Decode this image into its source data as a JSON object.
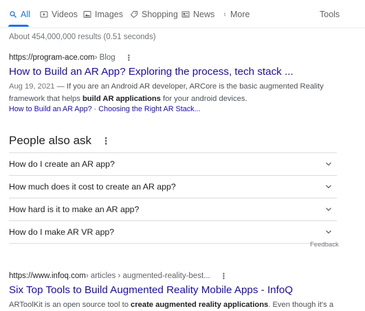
{
  "tabs": [
    {
      "label": "All",
      "icon": "search-icon",
      "active": true
    },
    {
      "label": "Videos",
      "icon": "video-icon"
    },
    {
      "label": "Images",
      "icon": "image-icon"
    },
    {
      "label": "Shopping",
      "icon": "tag-icon"
    },
    {
      "label": "News",
      "icon": "news-icon"
    },
    {
      "label": "More",
      "icon": "more-vert-icon"
    }
  ],
  "tools_label": "Tools",
  "stats": "About 454,000,000 results (0.51 seconds)",
  "result1": {
    "url": "https://program-ace.com",
    "crumb": " › Blog",
    "title": "How to Build an AR App? Exploring the process, tech stack ...",
    "date": "Aug 19, 2021",
    "snippet_a": " — If you are an Android AR developer, ARCore is the basic augmented Reality framework that helps ",
    "snippet_bold": "build AR applications",
    "snippet_b": " for your android devices.",
    "link1": "How to Build an AR App?",
    "link_sep": " · ",
    "link2": "Choosing the Right AR Stack..."
  },
  "paa": {
    "title": "People also ask",
    "questions": [
      "How do I create an AR app?",
      "How much does it cost to create an AR app?",
      "How hard is it to make an AR app?",
      "How do I make AR VR app?"
    ],
    "feedback": "Feedback"
  },
  "result2": {
    "url": "https://www.infoq.com",
    "crumb": " › articles › augmented-reality-best...",
    "title": "Six Top Tools to Build Augmented Reality Mobile Apps - InfoQ",
    "snippet_a": "ARToolKit is an open source tool to ",
    "snippet_bold": "create augmented reality applications",
    "snippet_b": ". Even though it's a"
  },
  "colors": {
    "link": "#1a0dab",
    "accent": "#1a73e8",
    "muted": "#70757a"
  }
}
